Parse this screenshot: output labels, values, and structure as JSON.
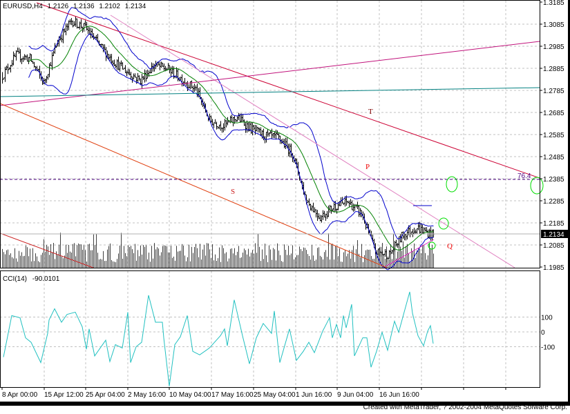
{
  "header": {
    "symbol_label": "EURUSD,H4",
    "open": "1.2126",
    "high": "1.2136",
    "low": "1.2102",
    "close": "1.2134"
  },
  "indicator": {
    "label": "CCI(14)",
    "value": "-90.0101"
  },
  "current_price_label": "1.2134",
  "annotations": {
    "T": "T",
    "P": "P",
    "S": "S",
    "Q": "Q",
    "fib": "76.4"
  },
  "footer": "Created with MetaTrader, ? 2002-2004 MetaQuotes Sofware Corp.",
  "colors": {
    "bars": "#000000",
    "bands": "#0000cc",
    "ma": "#008000",
    "cci": "#20c0c0",
    "trend_red": "#cc0033",
    "trend_pink": "#e080c0",
    "trend_magenta": "#c0107a",
    "trend_teal": "#008080",
    "trend_orange": "#e04010",
    "fib": "#4b0082",
    "circles": "#00dd00"
  },
  "chart_data": [
    {
      "type": "ohlc",
      "title": "EURUSD,H4",
      "price_ticks": [
        "1.3185",
        "1.3085",
        "1.2985",
        "1.2885",
        "1.2785",
        "1.2685",
        "1.2585",
        "1.2485",
        "1.2385",
        "1.2285",
        "1.2185",
        "1.2085",
        "1.1985"
      ],
      "ylim": [
        1.1985,
        1.3185
      ],
      "time_ticks": [
        "8 Apr 00:00",
        "15 Apr 12:00",
        "25 Apr 04:00",
        "2 May 16:00",
        "10 May 04:00",
        "17 May 16:00",
        "25 May 04:00",
        "1 Jun 16:00",
        "9 Jun 04:00",
        "16 Jun 16:00"
      ],
      "close_samples_every_10_bars": [
        1.2851,
        1.2944,
        1.2929,
        1.2819,
        1.3007,
        1.31,
        1.3069,
        1.2991,
        1.292,
        1.287,
        1.283,
        1.29,
        1.288,
        1.2835,
        1.279,
        1.2648,
        1.2625,
        1.2663,
        1.261,
        1.258,
        1.2569,
        1.25,
        1.2288,
        1.221,
        1.226,
        1.228,
        1.2226,
        1.2054,
        1.204,
        1.2132,
        1.2163,
        1.2134
      ],
      "bollinger": {
        "period": 20,
        "deviation": 2
      },
      "fib_level": {
        "label": "76.4",
        "price": 1.2385
      }
    },
    {
      "type": "line",
      "title": "CCI(14)",
      "ticks": [
        "100",
        "0",
        "-100"
      ],
      "ylim": [
        -380,
        290
      ],
      "points": [
        [
          1,
          -170
        ],
        [
          7,
          110
        ],
        [
          13,
          95
        ],
        [
          17,
          -40
        ],
        [
          21,
          -70
        ],
        [
          28,
          -207
        ],
        [
          33,
          -10
        ],
        [
          34,
          80
        ],
        [
          38,
          156
        ],
        [
          43,
          65
        ],
        [
          47,
          118
        ],
        [
          53,
          133
        ],
        [
          58,
          35
        ],
        [
          61,
          -117
        ],
        [
          63,
          20
        ],
        [
          67,
          -162
        ],
        [
          75,
          -56
        ],
        [
          78,
          -200
        ],
        [
          82,
          -86
        ],
        [
          87,
          -109
        ],
        [
          91,
          133
        ],
        [
          93,
          -207
        ],
        [
          97,
          -100
        ],
        [
          101,
          -70
        ],
        [
          106,
          247
        ],
        [
          111,
          65
        ],
        [
          116,
          65
        ],
        [
          117,
          -40
        ],
        [
          121,
          -366
        ],
        [
          125,
          -86
        ],
        [
          129,
          -33
        ],
        [
          134,
          110
        ],
        [
          138,
          -131
        ],
        [
          143,
          -155
        ],
        [
          150,
          -109
        ],
        [
          158,
          -26
        ],
        [
          161,
          20
        ],
        [
          163,
          -94
        ],
        [
          168,
          216
        ],
        [
          174,
          -26
        ],
        [
          179,
          -215
        ],
        [
          184,
          -40
        ],
        [
          189,
          57
        ],
        [
          195,
          -10
        ],
        [
          197,
          141
        ],
        [
          201,
          -207
        ],
        [
          208,
          20
        ],
        [
          213,
          -192
        ],
        [
          218,
          -131
        ],
        [
          222,
          -70
        ],
        [
          226,
          -140
        ],
        [
          232,
          5
        ],
        [
          237,
          95
        ],
        [
          239,
          -40
        ],
        [
          242,
          50
        ],
        [
          245,
          -40
        ],
        [
          247,
          110
        ],
        [
          249,
          27
        ],
        [
          253,
          186
        ],
        [
          255,
          -162
        ],
        [
          261,
          -40
        ],
        [
          264,
          -40
        ],
        [
          267,
          -238
        ],
        [
          271,
          -131
        ],
        [
          275,
          -3
        ],
        [
          279,
          -124
        ],
        [
          284,
          72
        ],
        [
          287,
          -3
        ],
        [
          289,
          65
        ],
        [
          295,
          270
        ],
        [
          297,
          126
        ],
        [
          301,
          -26
        ],
        [
          305,
          -94
        ],
        [
          308,
          5
        ],
        [
          310,
          42
        ],
        [
          312,
          -79
        ]
      ]
    }
  ]
}
